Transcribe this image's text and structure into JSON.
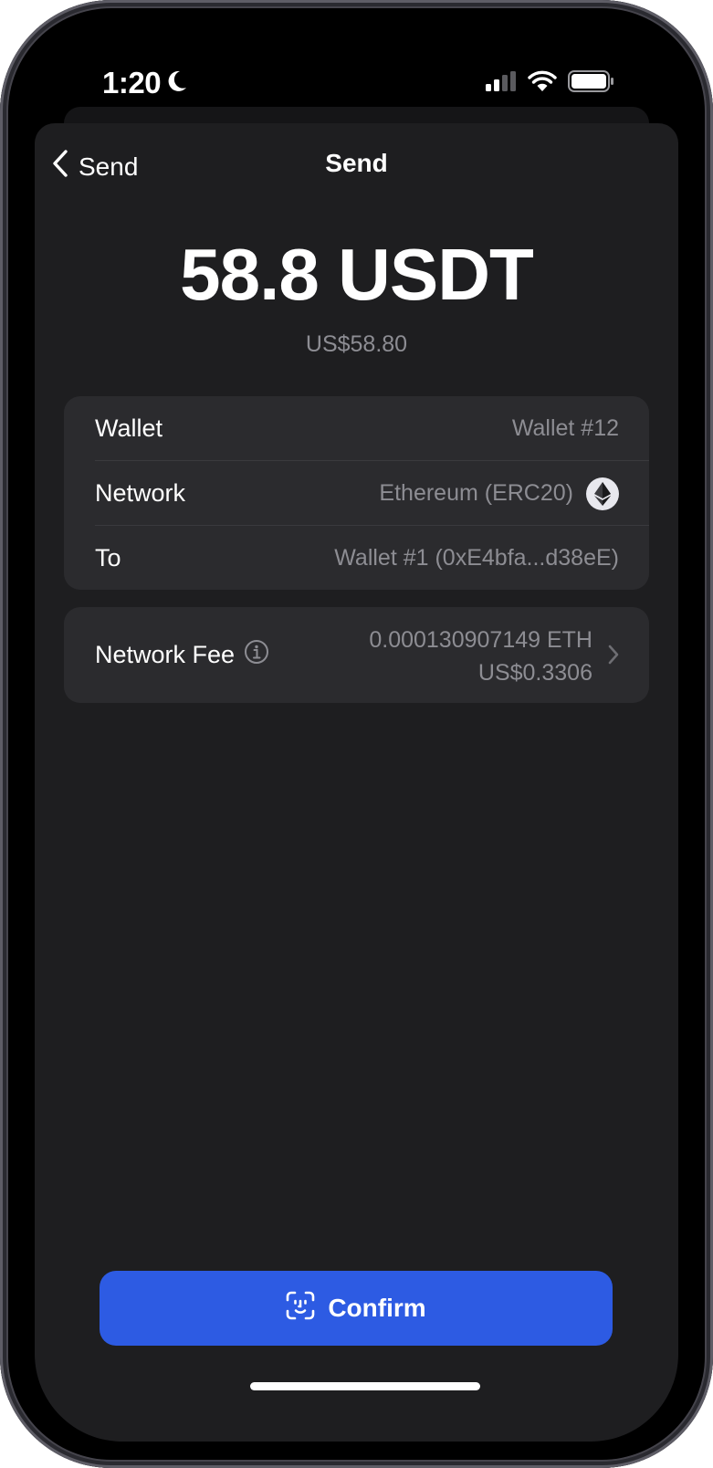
{
  "status_bar": {
    "time": "1:20",
    "icons": [
      "moon-icon",
      "cellular-signal-icon",
      "wifi-icon",
      "battery-icon"
    ]
  },
  "nav": {
    "back_label": "Send",
    "title": "Send"
  },
  "amount": {
    "value": "58.8 USDT",
    "fiat": "US$58.80"
  },
  "details": {
    "wallet_label": "Wallet",
    "wallet_value": "Wallet #12",
    "network_label": "Network",
    "network_value": "Ethereum (ERC20)",
    "network_icon": "ethereum-icon",
    "to_label": "To",
    "to_value": "Wallet #1 (0xE4bfa...d38eE)"
  },
  "fee": {
    "label": "Network Fee",
    "eth_value": "0.000130907149 ETH",
    "fiat_value": "US$0.3306"
  },
  "confirm": {
    "label": "Confirm",
    "icon": "face-id-icon"
  },
  "colors": {
    "accent": "#2d5be3",
    "sheet": "#1e1e20",
    "card": "#2b2b2e",
    "secondary_text": "#8d8d93"
  }
}
